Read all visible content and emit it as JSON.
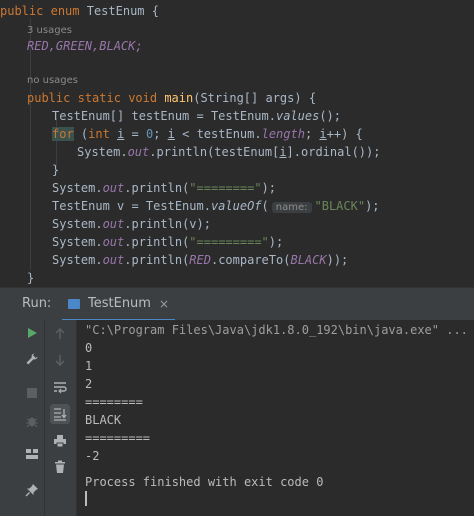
{
  "editor": {
    "enum_decl": {
      "kw1": "public",
      "kw2": "enum",
      "name": "TestEnum",
      "brace": "{"
    },
    "usages_hint": "3 usages",
    "constants": "RED,GREEN,BLACK;",
    "no_usages_hint": "no usages",
    "main_decl": {
      "kw1": "public",
      "kw2": "static",
      "kw3": "void",
      "fn": "main",
      "params": "(String[] args) {"
    },
    "line_values": {
      "pre": "TestEnum[] testEnum = TestEnum.",
      "method": "values",
      "post": "();"
    },
    "line_for": {
      "kw": "for",
      "p1": " (",
      "kw2": "int",
      "sp": " ",
      "v1": "i",
      "p2": " = ",
      "num": "0",
      "p3": "; ",
      "v2": "i",
      "p4": " < testEnum.",
      "fld": "length",
      "p5": "; ",
      "v3": "i",
      "p6": "++) {"
    },
    "line_print_ordinal": {
      "pre": "System.",
      "out": "out",
      "mid": ".println(testEnum[",
      "idx": "i",
      "post": "].ordinal());"
    },
    "close_for": "}",
    "line_print_sep1": {
      "pre": "System.",
      "out": "out",
      "mid": ".println(",
      "str": "\"========\"",
      "post": ");"
    },
    "line_valueof": {
      "pre": "TestEnum v = TestEnum.",
      "method": "valueOf",
      "paren": "(",
      "hint": "name:",
      "str": "\"BLACK\"",
      "post": ");"
    },
    "line_print_v": {
      "pre": "System.",
      "out": "out",
      "mid": ".println(v);"
    },
    "line_print_sep2": {
      "pre": "System.",
      "out": "out",
      "mid": ".println(",
      "str": "\"=========\"",
      "post": ");"
    },
    "line_compare": {
      "pre": "System.",
      "out": "out",
      "mid": ".println(",
      "c1": "RED",
      "mid2": ".compareTo(",
      "c2": "BLACK",
      "post": "));"
    },
    "close_main": "}"
  },
  "run_panel": {
    "label": "Run:",
    "tab_name": "TestEnum",
    "tab_close": "×"
  },
  "console": {
    "command": "\"C:\\Program Files\\Java\\jdk1.8.0_192\\bin\\java.exe\" ...",
    "lines": [
      "0",
      "1",
      "2",
      "========",
      "BLACK",
      "=========",
      "-2",
      "",
      "Process finished with exit code 0"
    ]
  },
  "icons": {
    "left_toolbar": [
      "run-icon",
      "wrench-icon",
      "stop-icon",
      "debug-bug-icon",
      "layout-icon",
      "pin-icon"
    ],
    "right_toolbar": [
      "arrow-up-icon",
      "arrow-down-icon",
      "soft-wrap-icon",
      "scroll-to-end-icon",
      "print-icon",
      "trash-icon"
    ]
  },
  "colors": {
    "run_green": "#59a869",
    "tab_blue": "#4a88c7",
    "keyword": "#cc7832",
    "string": "#6a8759",
    "enum_const": "#9876aa"
  }
}
